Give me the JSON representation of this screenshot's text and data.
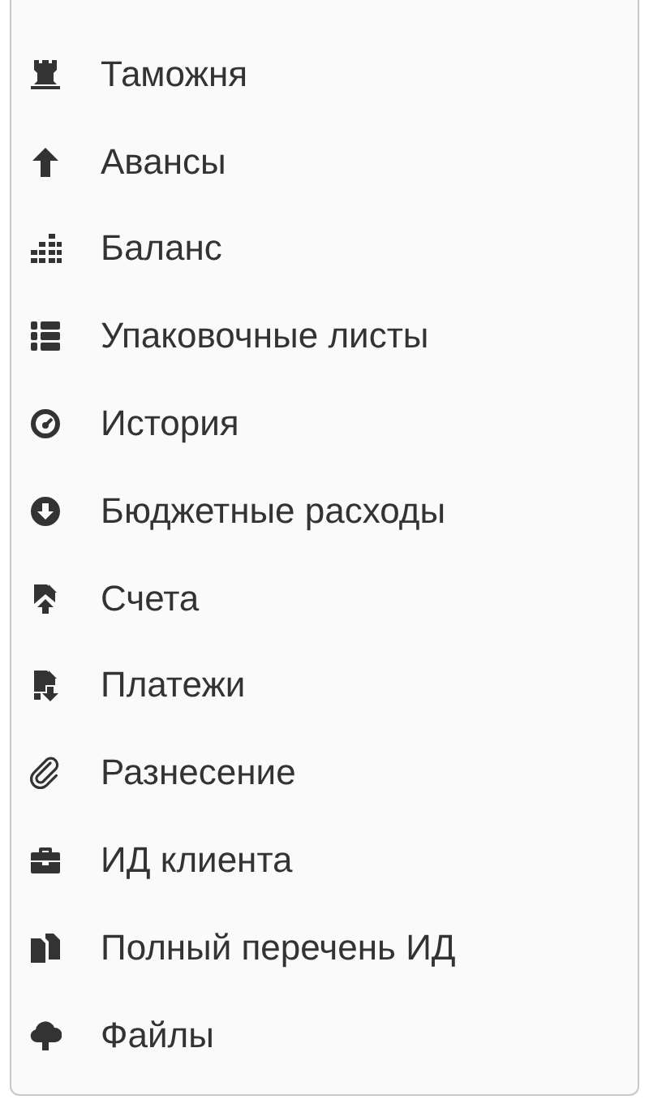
{
  "menu": {
    "items": [
      {
        "label": "Таможня"
      },
      {
        "label": "Авансы"
      },
      {
        "label": "Баланс"
      },
      {
        "label": "Упаковочные листы"
      },
      {
        "label": "История"
      },
      {
        "label": "Бюджетные расходы"
      },
      {
        "label": "Счета"
      },
      {
        "label": "Платежи"
      },
      {
        "label": "Разнесение"
      },
      {
        "label": "ИД клиента"
      },
      {
        "label": "Полный перечень ИД"
      },
      {
        "label": "Файлы"
      }
    ]
  }
}
